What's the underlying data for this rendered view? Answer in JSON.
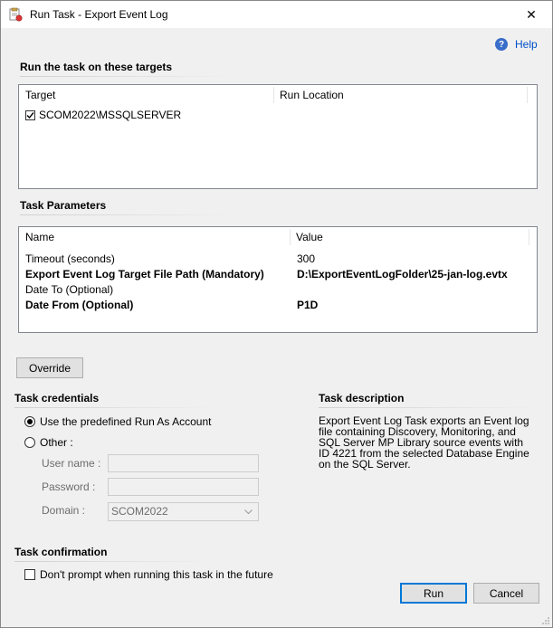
{
  "window": {
    "title": "Run Task - Export Event Log",
    "close_glyph": "✕",
    "help_label": "Help"
  },
  "targets": {
    "section_title": "Run the task on these targets",
    "columns": [
      "Target",
      "Run Location"
    ],
    "rows": [
      {
        "checked": true,
        "target": "SCOM2022\\MSSQLSERVER",
        "run_location": ""
      }
    ]
  },
  "parameters": {
    "section_title": "Task Parameters",
    "columns": [
      "Name",
      "Value"
    ],
    "rows": [
      {
        "name": "Timeout (seconds)",
        "value": "300",
        "bold": false
      },
      {
        "name": "Export Event Log Target File Path (Mandatory)",
        "value": "D:\\ExportEventLogFolder\\25-jan-log.evtx",
        "bold": true
      },
      {
        "name": "Date To (Optional)",
        "value": "",
        "bold": false
      },
      {
        "name": "Date From (Optional)",
        "value": "P1D",
        "bold": true
      }
    ]
  },
  "override_label": "Override",
  "credentials": {
    "section_title": "Task credentials",
    "option_predefined": "Use the predefined Run As Account",
    "option_other": "Other :",
    "selected": "predefined",
    "user_name_label": "User name :",
    "password_label": "Password :",
    "domain_label": "Domain :",
    "user_name_value": "",
    "password_value": "",
    "domain_value": "SCOM2022"
  },
  "description": {
    "section_title": "Task description",
    "text": "Export Event Log Task exports an Event log file containing Discovery, Monitoring, and SQL Server MP Library source events with ID 4221 from the selected Database Engine on the SQL Server."
  },
  "confirmation": {
    "section_title": "Task confirmation",
    "dont_prompt_label": "Don't prompt when running this task in the future",
    "dont_prompt_checked": false
  },
  "buttons": {
    "run": "Run",
    "cancel": "Cancel"
  },
  "colors": {
    "accent": "#0078d7",
    "link": "#0050c8",
    "disabled_text": "#6d6d6d"
  }
}
